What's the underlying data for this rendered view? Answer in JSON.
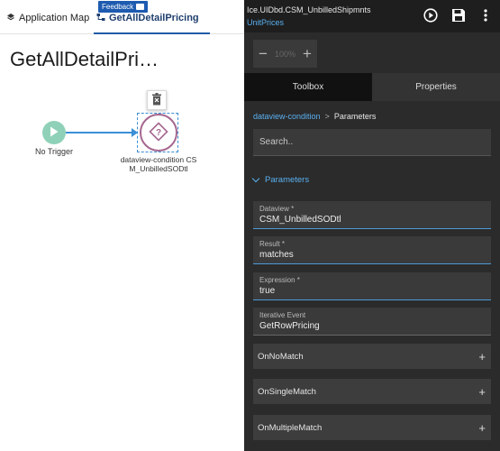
{
  "left": {
    "tabs": [
      {
        "label": "Application Map",
        "icon": "layers-icon"
      },
      {
        "label": "GetAllDetailPricing",
        "icon": "flow-icon"
      }
    ],
    "feedback_label": "Feedback",
    "page_title": "GetAllDetailPri…",
    "nodes": {
      "trigger_label": "No Trigger",
      "condition_label": "dataview-condition CSM_UnbilledSODtl"
    }
  },
  "right": {
    "title": "Ice.UIDbd.CSM_UnbilledShipmnts",
    "subtitle": "UnitPrices",
    "zoom": {
      "minus": "−",
      "value": "100%",
      "plus": "+"
    },
    "tabs": [
      "Toolbox",
      "Properties"
    ],
    "breadcrumb": {
      "parent": "dataview-condition",
      "separator": ">",
      "current": "Parameters"
    },
    "search_placeholder": "Search..",
    "section_title": "Parameters",
    "fields": [
      {
        "label": "Dataview *",
        "value": "CSM_UnbilledSODtl"
      },
      {
        "label": "Result *",
        "value": "matches"
      },
      {
        "label": "Expression *",
        "value": "true"
      },
      {
        "label": "Iterative Event",
        "value": "GetRowPricing"
      }
    ],
    "expanders": [
      {
        "label": "OnNoMatch",
        "icon": "+"
      },
      {
        "label": "OnSingleMatch",
        "icon": "+"
      },
      {
        "label": "OnMultipleMatch",
        "icon": "+"
      }
    ]
  },
  "colors": {
    "accent": "#5ab0f0",
    "panel_bg": "#2b2b2b",
    "trigger_node": "#8fd1b8",
    "condition_node": "#a5678f",
    "edge": "#3b8fd6"
  }
}
